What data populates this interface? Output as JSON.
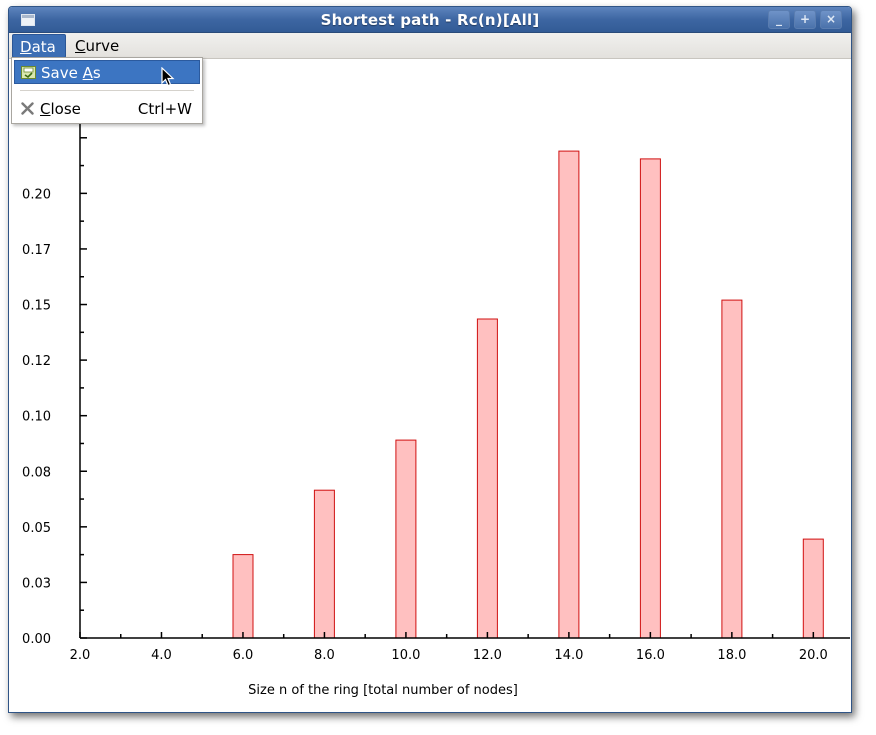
{
  "window": {
    "title": "Shortest path - Rc(n)[All]",
    "controls": {
      "minimize": "_",
      "maximize": "+",
      "close": "×"
    }
  },
  "menubar": {
    "items": [
      {
        "label": "Data",
        "mnemonic": "D",
        "rest": "ata",
        "active": true
      },
      {
        "label": "Curve",
        "mnemonic": "C",
        "rest": "urve",
        "active": false
      }
    ]
  },
  "dropdown": {
    "items": [
      {
        "label_pre": "Save ",
        "mnemonic": "A",
        "label_post": "s",
        "accel": "",
        "icon": "save-as-icon",
        "highlighted": true
      },
      {
        "label_pre": "",
        "mnemonic": "C",
        "label_post": "lose",
        "accel": "Ctrl+W",
        "icon": "close-icon",
        "highlighted": false
      }
    ]
  },
  "chart_data": {
    "type": "bar",
    "xlabel": "Size n of the ring [total number of nodes]",
    "ylabel": "",
    "title": "",
    "x_ticks": [
      "2.0",
      "4.0",
      "6.0",
      "8.0",
      "10.0",
      "12.0",
      "14.0",
      "16.0",
      "18.0",
      "20.0"
    ],
    "y_ticks": [
      "0.00",
      "0.03",
      "0.05",
      "0.08",
      "0.10",
      "0.12",
      "0.15",
      "0.17",
      "0.20"
    ],
    "xlim": [
      2.0,
      20.9
    ],
    "ylim": [
      0.0,
      0.2375
    ],
    "bar_color": "#ffc0c0",
    "bar_edge": "#d01010",
    "x": [
      6,
      8,
      10,
      12,
      14,
      16,
      18,
      20
    ],
    "values": [
      0.0375,
      0.0665,
      0.089,
      0.1435,
      0.219,
      0.2155,
      0.152,
      0.0445
    ]
  }
}
